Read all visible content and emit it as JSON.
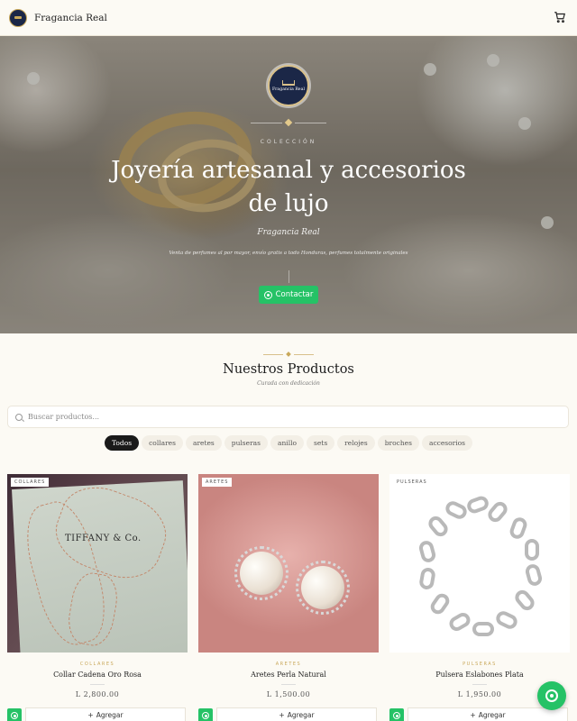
{
  "header": {
    "brand": "Fragancia Real",
    "cart_icon": "cart-icon"
  },
  "hero": {
    "logo_text": "Fragancia Real",
    "eyebrow": "COLECCIÓN",
    "title": "Joyería artesanal y accesorios de lujo",
    "subtitle": "Fragancia Real",
    "description": "Venta de perfumes al por mayor, envío gratis a todo Honduras, perfumes totalmente originales",
    "contact_button": "Contactar"
  },
  "products_section": {
    "title": "Nuestros Productos",
    "subtitle": "Curada con dedicación",
    "search_placeholder": "Buscar productos...",
    "filters": [
      "Todos",
      "collares",
      "aretes",
      "pulseras",
      "anillo",
      "sets",
      "relojes",
      "broches",
      "accesorios"
    ],
    "active_filter": "Todos"
  },
  "products": [
    {
      "tag": "COLLARES",
      "category": "COLLARES",
      "name": "Collar Cadena Oro Rosa",
      "price": "L 2,800.00",
      "add_label": "Agregar",
      "box_text": "TIFFANY & Co."
    },
    {
      "tag": "ARETES",
      "category": "ARETES",
      "name": "Aretes Perla Natural",
      "price": "L 1,500.00",
      "add_label": "Agregar"
    },
    {
      "tag": "PULSERAS",
      "category": "PULSERAS",
      "name": "Pulsera Eslabones Plata",
      "price": "L 1,950.00",
      "add_label": "Agregar"
    }
  ],
  "colors": {
    "accent_green": "#25c266",
    "gold": "#c9a85a",
    "navy": "#1b2747",
    "background": "#fcfaf4"
  }
}
